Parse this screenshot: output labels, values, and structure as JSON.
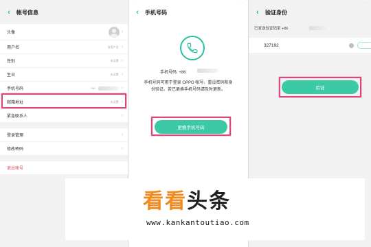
{
  "panel1": {
    "title": "帐号信息",
    "rows": [
      {
        "label": "头像"
      },
      {
        "label": "用户名",
        "value": "该用户名"
      },
      {
        "label": "性别",
        "value": "未设置"
      },
      {
        "label": "生日",
        "value": "未设置"
      },
      {
        "label": "手机号码",
        "value": "+86"
      },
      {
        "label": "邮箱地址",
        "value": "未设置"
      },
      {
        "label": "紧急联系人"
      }
    ],
    "rows2": [
      {
        "label": "登录管理"
      },
      {
        "label": "修改密码"
      }
    ],
    "logout": "退出帐号"
  },
  "panel2": {
    "title": "手机号码",
    "phone_label": "手机号码: +86",
    "description": "手机号码可用于登录 OPPO 帐号、重设密码和身份验证。若已更换手机号码请及时更新。",
    "button": "更换手机号码"
  },
  "panel3": {
    "title": "验证身份",
    "hint": "已发送验证码至 +86",
    "code": "327192",
    "button": "验证"
  },
  "watermark": {
    "logo_part1": "看看",
    "logo_part2": "头条",
    "url": "www.kankantoutiao.com"
  },
  "colors": {
    "accent": "#2bbf9f",
    "button": "#3ccaa6",
    "highlight": "#d9487a",
    "logout": "#e0506a"
  }
}
